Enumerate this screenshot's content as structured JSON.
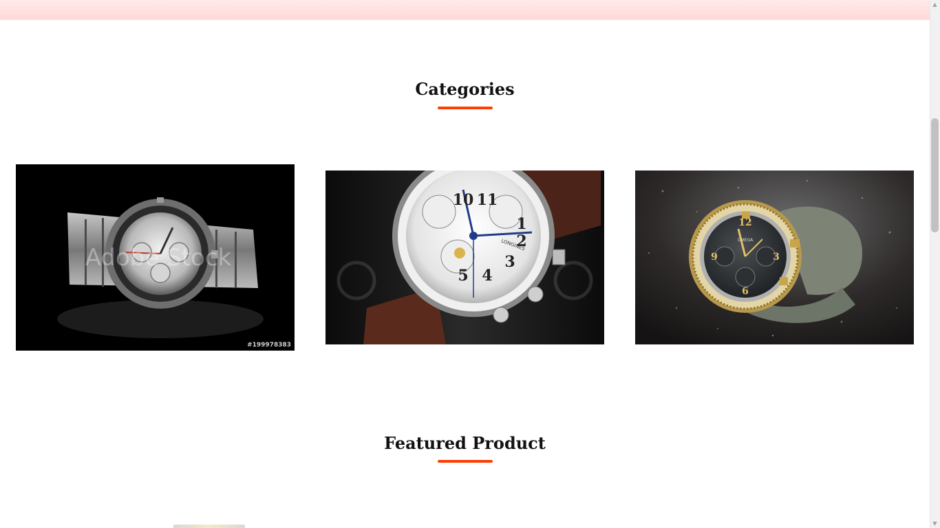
{
  "header": {
    "bar_color": "#ffdcdc"
  },
  "categories_section": {
    "title": "Categories",
    "underline_color": "#ff3d00",
    "cards": [
      {
        "alt": "silver chronograph watch on black background",
        "watermark": "Adobe Stock",
        "stock_id": "#199978383"
      },
      {
        "alt": "Longines chronograph watch with brown leather strap",
        "brand_text": "LONGINES"
      },
      {
        "alt": "Omega watch with gold bezel and grey strap",
        "brand_text": "OMEGA"
      }
    ]
  },
  "featured_section": {
    "title": "Featured Product",
    "underline_color": "#ff3d00"
  },
  "scrollbar": {
    "up_icon": "scroll-up-arrow",
    "down_icon": "scroll-down-arrow"
  }
}
